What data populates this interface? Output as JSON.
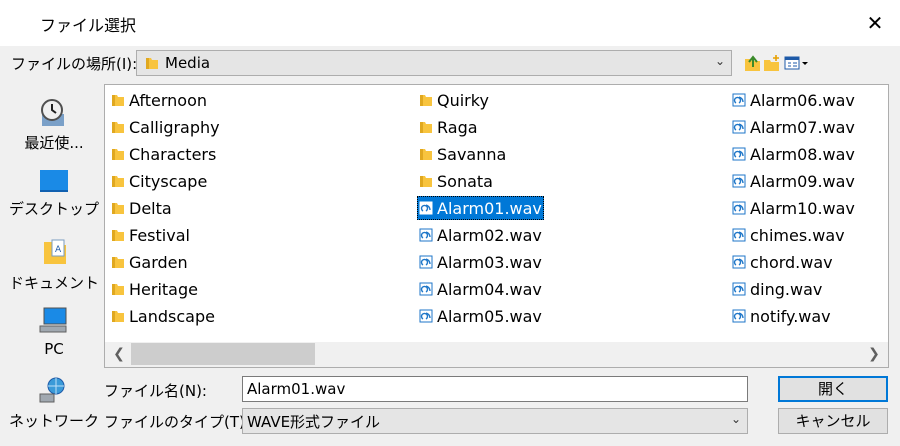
{
  "dialog": {
    "title": "ファイル選択",
    "close": "✕"
  },
  "lookin": {
    "label": "ファイルの場所(I):",
    "value": "Media"
  },
  "toolbar": {
    "up": "up-folder-icon",
    "new_folder": "new-folder-icon",
    "view_menu": "view-menu-icon"
  },
  "places": [
    {
      "label": "最近使...",
      "icon": "recent-icon"
    },
    {
      "label": "デスクトップ",
      "icon": "desktop-icon"
    },
    {
      "label": "ドキュメント",
      "icon": "documents-icon"
    },
    {
      "label": "PC",
      "icon": "pc-icon"
    },
    {
      "label": "ネットワーク",
      "icon": "network-icon"
    }
  ],
  "files": {
    "col1": [
      "Afternoon",
      "Calligraphy",
      "Characters",
      "Cityscape",
      "Delta",
      "Festival",
      "Garden",
      "Heritage",
      "Landscape"
    ],
    "col2": [
      "Quirky",
      "Raga",
      "Savanna",
      "Sonata",
      "Alarm01.wav",
      "Alarm02.wav",
      "Alarm03.wav",
      "Alarm04.wav",
      "Alarm05.wav"
    ],
    "col3": [
      "Alarm06.wav",
      "Alarm07.wav",
      "Alarm08.wav",
      "Alarm09.wav",
      "Alarm10.wav",
      "chimes.wav",
      "chord.wav",
      "ding.wav",
      "notify.wav"
    ],
    "selected": "Alarm01.wav"
  },
  "filename": {
    "label": "ファイル名(N):",
    "value": "Alarm01.wav"
  },
  "filetype": {
    "label": "ファイルのタイプ(T):",
    "value": "WAVE形式ファイル"
  },
  "buttons": {
    "open": "開く",
    "cancel": "キャンセル"
  },
  "colors": {
    "selection": "#0078d7",
    "folder": "#f8c43e",
    "wav_icon": "#1e76c8"
  }
}
